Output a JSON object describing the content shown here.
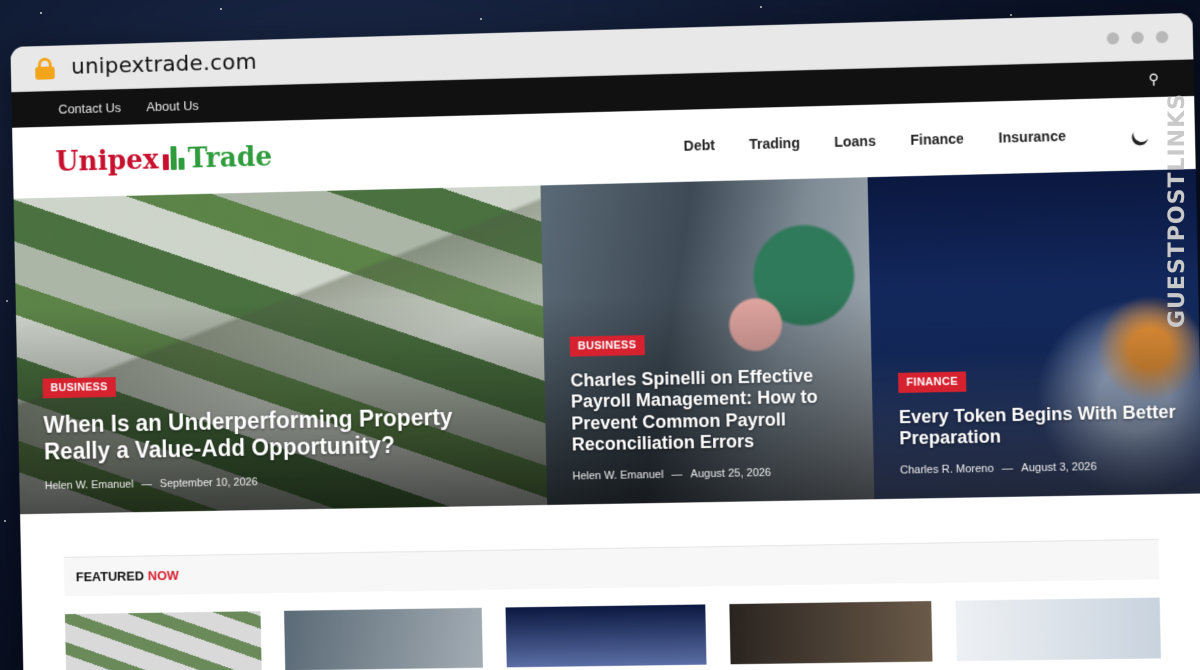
{
  "browser": {
    "url": "unipextrade.com"
  },
  "topbar": {
    "links": [
      "Contact Us",
      "About Us"
    ]
  },
  "logo": {
    "part1": "Unipex",
    "part2": "Trade"
  },
  "nav": {
    "items": [
      "Debt",
      "Trading",
      "Loans",
      "Finance",
      "Insurance"
    ]
  },
  "hero": [
    {
      "category": "BUSINESS",
      "title": "When Is an Underperforming Property Really a Value-Add Opportunity?",
      "author": "Helen W. Emanuel",
      "date": "September 10, 2026"
    },
    {
      "category": "BUSINESS",
      "title": "Charles Spinelli on Effective Payroll Management: How to Prevent Common Payroll Reconciliation Errors",
      "author": "Helen W. Emanuel",
      "date": "August 25, 2026"
    },
    {
      "category": "FINANCE",
      "title": "Every Token Begins With Better Preparation",
      "author": "Charles R. Moreno",
      "date": "August 3, 2026"
    }
  ],
  "featured": {
    "label": "FEATURED",
    "highlight": "NOW"
  },
  "watermark": "GUESTPOSTLINKS"
}
